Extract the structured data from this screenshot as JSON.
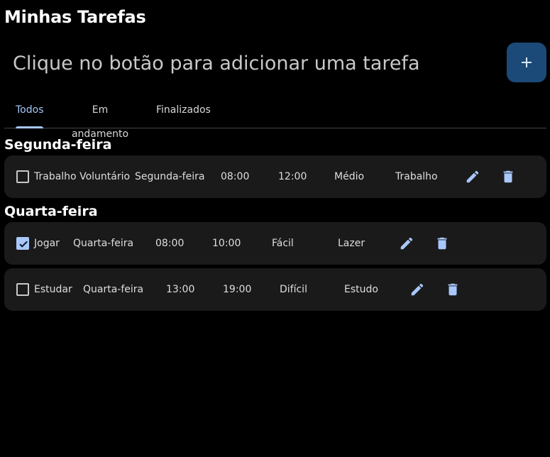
{
  "header": {
    "title": "Minhas Tarefas"
  },
  "new_task": {
    "placeholder": "Clique no botão para adicionar uma tarefa",
    "add_label": "+"
  },
  "tabs": [
    {
      "label": "Todos",
      "active": true
    },
    {
      "label": "Em andamento",
      "active": false
    },
    {
      "label": "Finalizados",
      "active": false
    }
  ],
  "groups": [
    {
      "day": "Segunda-feira",
      "tasks": [
        {
          "checked": false,
          "name": "Trabalho Voluntário",
          "day": "Segunda-feira",
          "start": "08:00",
          "end": "12:00",
          "difficulty": "Médio",
          "category": "Trabalho"
        }
      ]
    },
    {
      "day": "Quarta-feira",
      "tasks": [
        {
          "checked": true,
          "name": "Jogar",
          "day": "Quarta-feira",
          "start": "08:00",
          "end": "10:00",
          "difficulty": "Fácil",
          "category": "Lazer"
        },
        {
          "checked": false,
          "name": "Estudar",
          "day": "Quarta-feira",
          "start": "13:00",
          "end": "19:00",
          "difficulty": "Difícil",
          "category": "Estudo"
        }
      ]
    }
  ],
  "icons": {
    "edit": "pencil-icon",
    "delete": "trash-icon",
    "check": "check-icon",
    "add": "plus-icon"
  },
  "colors": {
    "accent": "#a8c7fa",
    "add_button_bg": "#1b4a78",
    "row_bg": "#1a1a1a",
    "background": "#000000"
  }
}
